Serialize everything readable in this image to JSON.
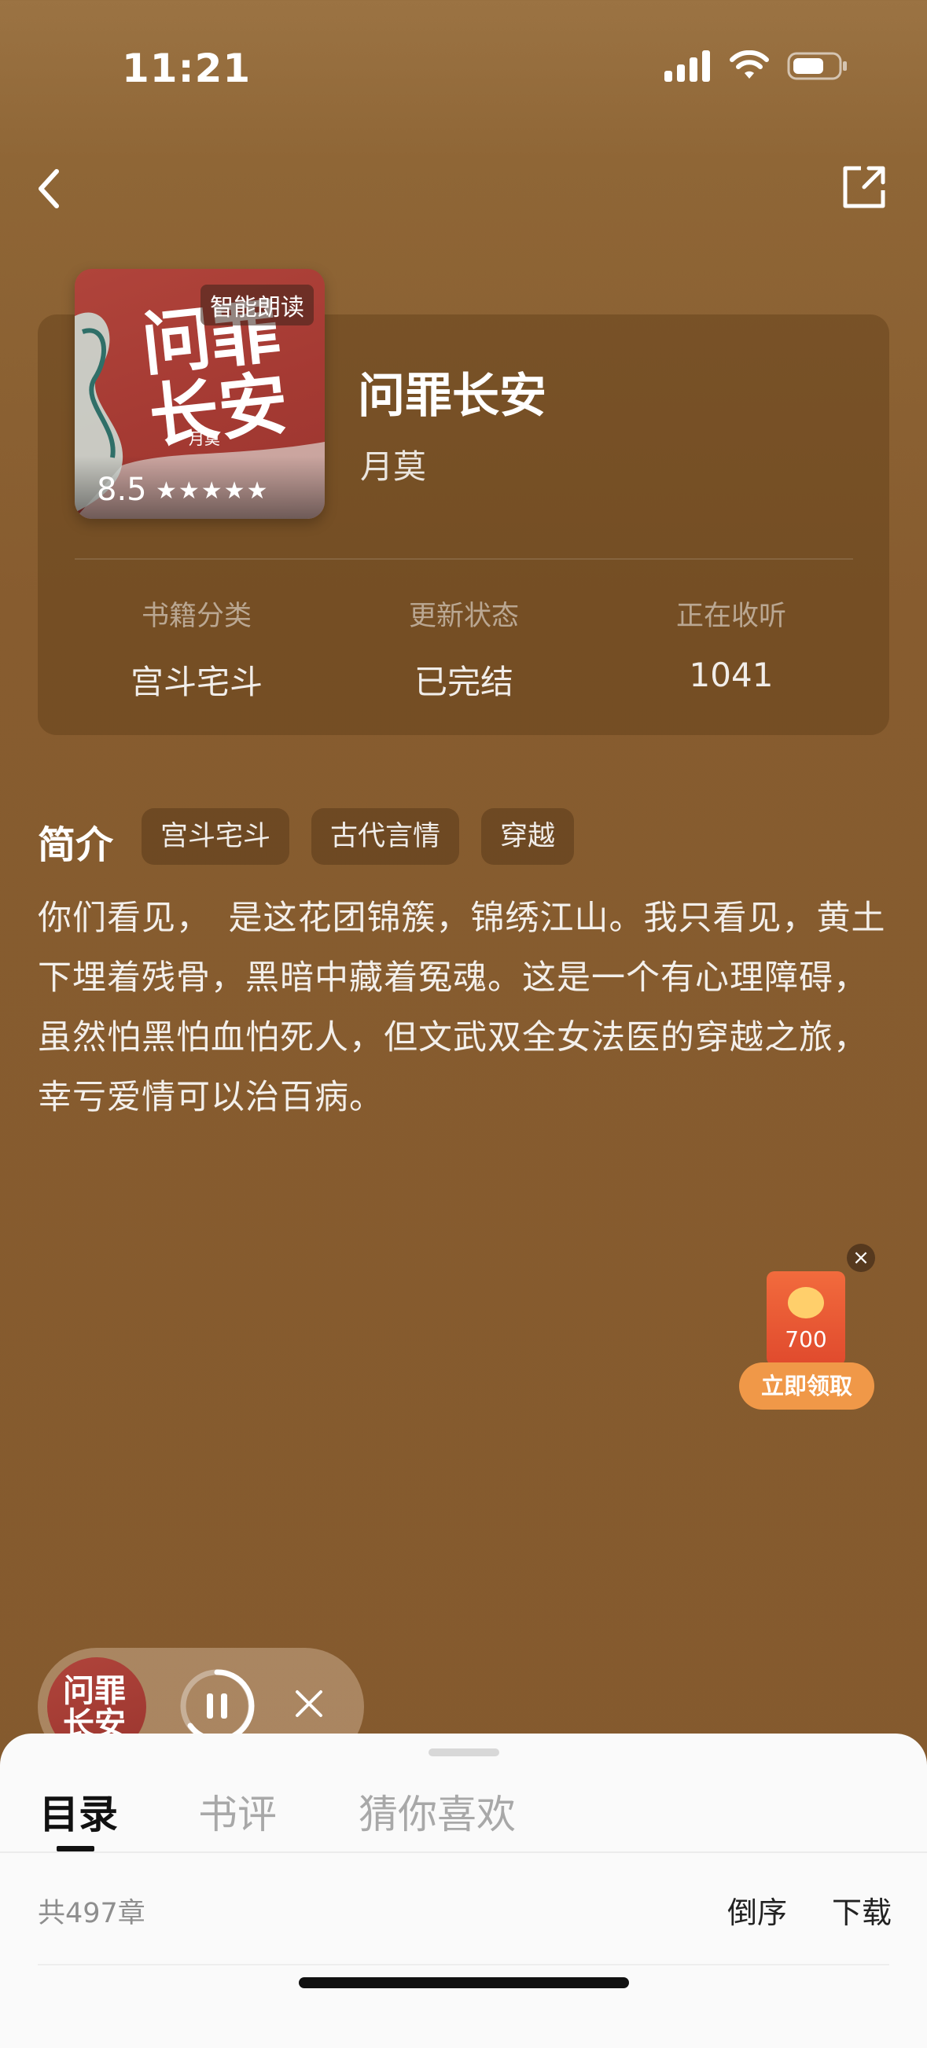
{
  "status": {
    "time": "11:21"
  },
  "nav": {
    "back_icon": "chevron-left-icon",
    "share_icon": "share-icon"
  },
  "book": {
    "cover_tag": "智能朗读",
    "cover_title": "问罪长安",
    "cover_author": "月莫",
    "score": "8.5",
    "stars": "★★★★★",
    "title": "问罪长安",
    "author": "月莫"
  },
  "stats": [
    {
      "label": "书籍分类",
      "value": "宫斗宅斗"
    },
    {
      "label": "更新状态",
      "value": "已完结"
    },
    {
      "label": "正在收听",
      "value": "1041"
    }
  ],
  "intro": {
    "heading": "简介",
    "tags": [
      "宫斗宅斗",
      "古代言情",
      "穿越"
    ],
    "text": "你们看见，　是这花团锦簇，锦绣江山。我只看见，黄土下埋着残骨，黑暗中藏着冤魂。这是一个有心理障碍，虽然怕黑怕血怕死人，但文武双全女法医的穿越之旅，幸亏爱情可以治百病。"
  },
  "red_packet": {
    "amount": "700",
    "button": "立即领取",
    "close": "×"
  },
  "mini_player": {
    "cover_text": "问罪长安",
    "close": "✕"
  },
  "sheet": {
    "tabs": [
      "目录",
      "书评",
      "猜你喜欢"
    ],
    "chapter_count": "共497章",
    "sort": "倒序",
    "download": "下载"
  },
  "colors": {
    "background": "#875c2f",
    "accent": "#f09848",
    "sheet": "#fafafa"
  }
}
